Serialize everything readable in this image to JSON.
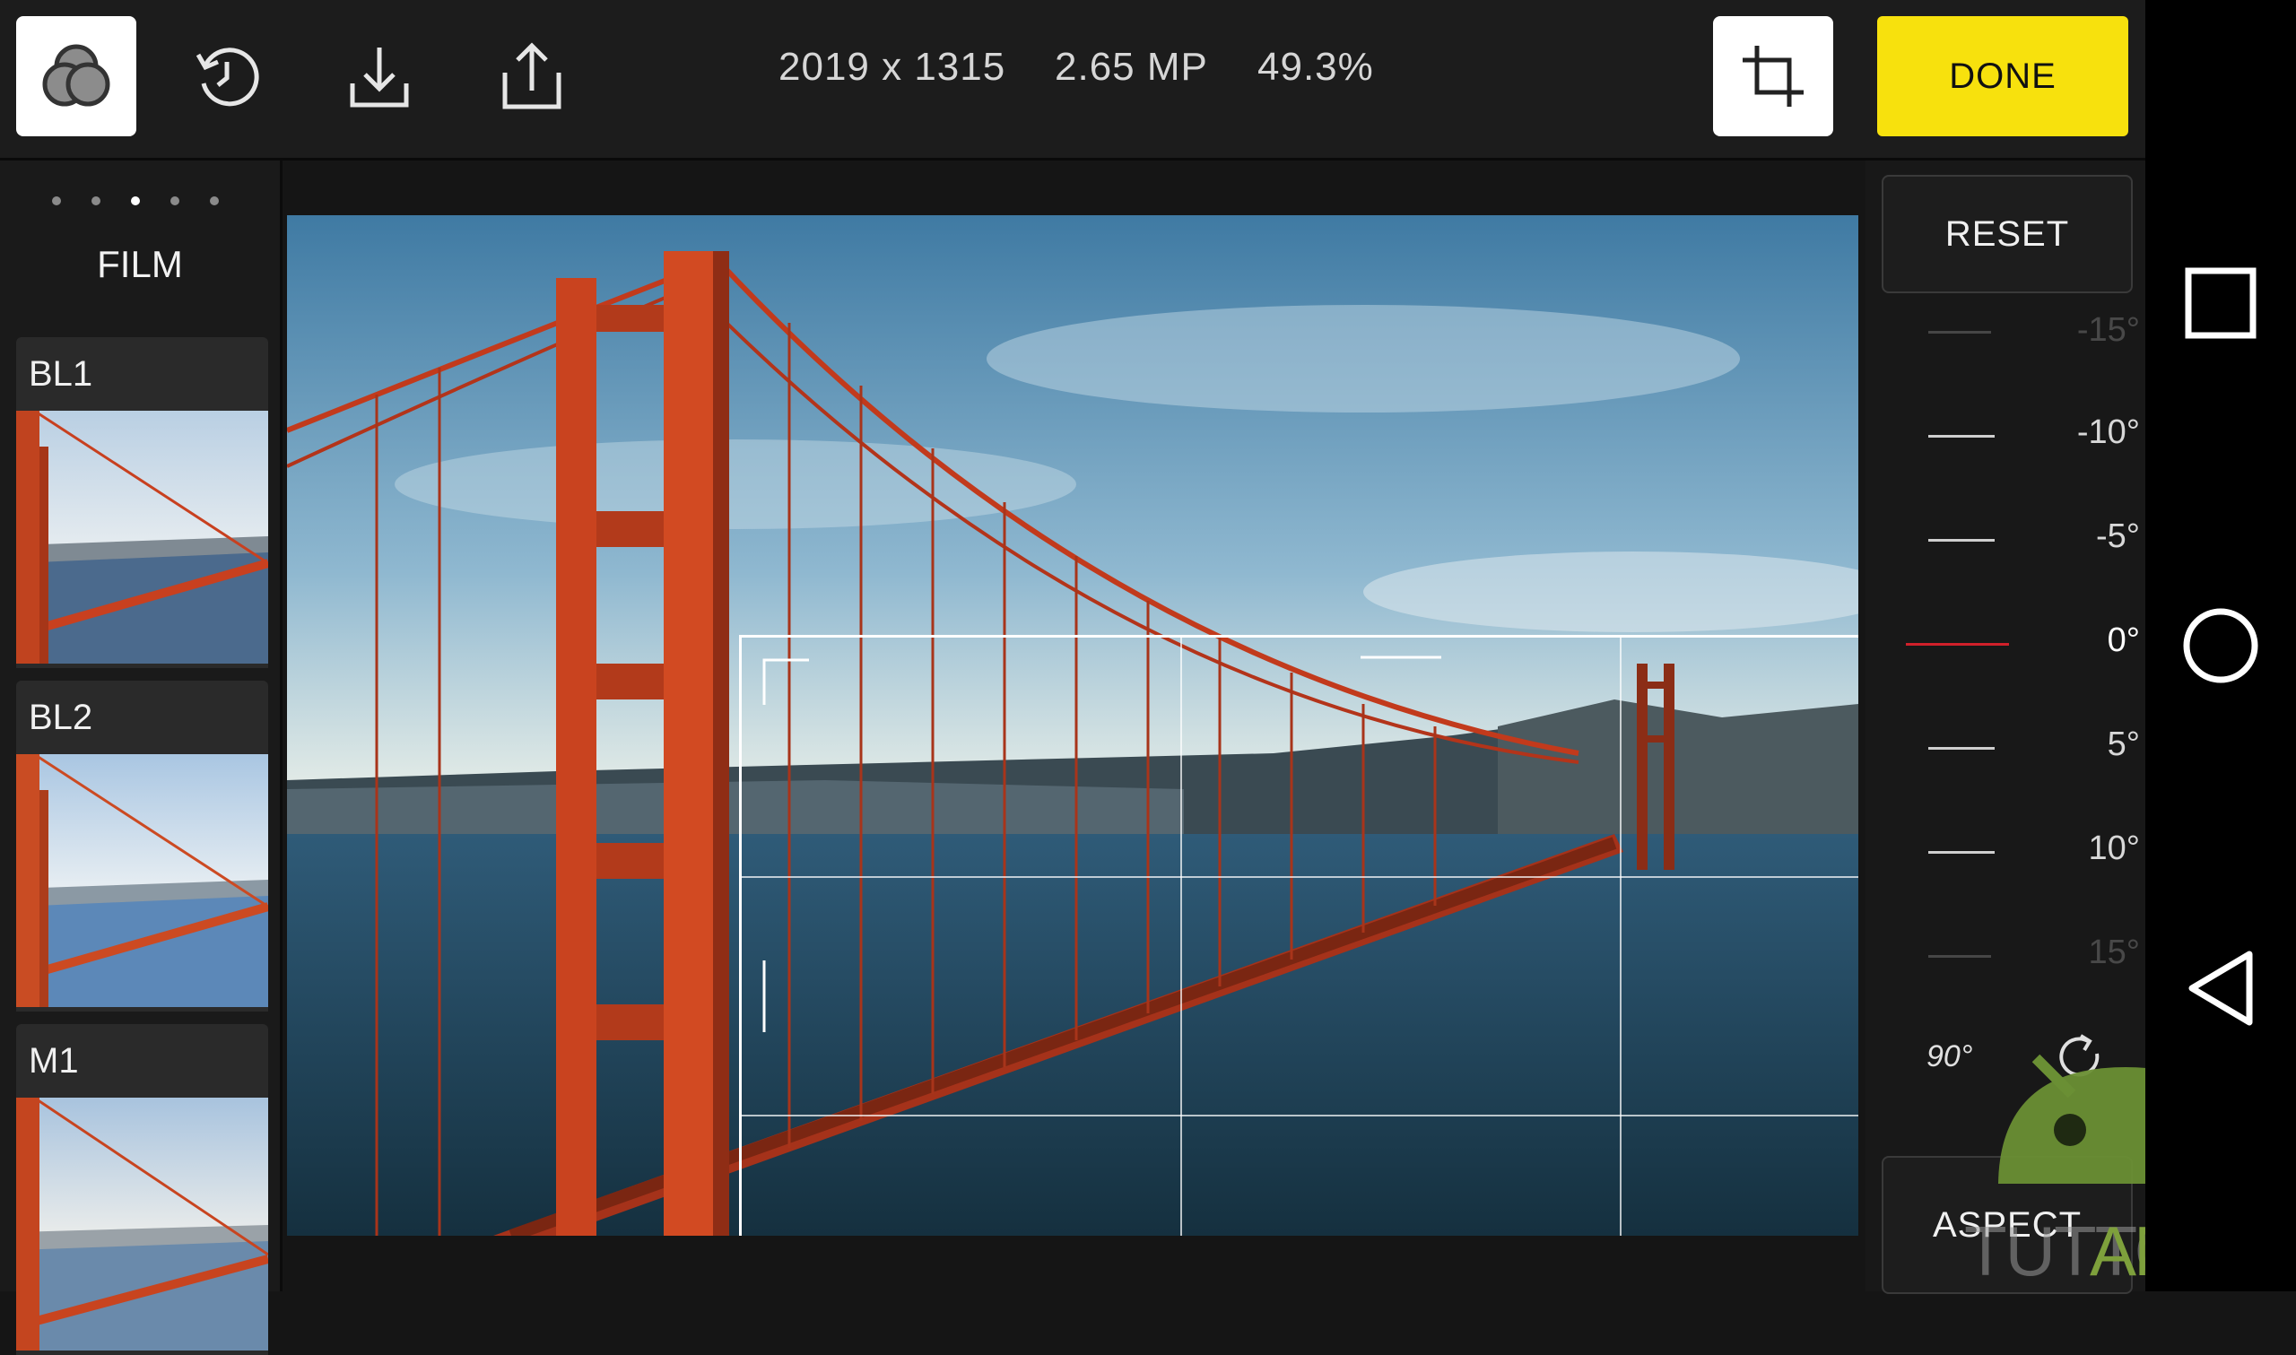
{
  "toolbar": {
    "image_dimensions": "2019 x 1315",
    "megapixels": "2.65 MP",
    "zoom": "49.3%",
    "done_label": "DONE",
    "icons": [
      "filters-icon",
      "history-icon",
      "download-icon",
      "share-icon",
      "crop-icon"
    ]
  },
  "filters": {
    "category": "FILM",
    "page_dots": 5,
    "active_dot": 3,
    "items": [
      {
        "label": "BL1"
      },
      {
        "label": "BL2"
      },
      {
        "label": "M1"
      }
    ]
  },
  "straighten": {
    "reset_label": "RESET",
    "faded_top": "-15°",
    "ticks": [
      {
        "label": "-10°",
        "value": -10
      },
      {
        "label": "-5°",
        "value": -5
      },
      {
        "label": "0°",
        "value": 0,
        "selected": true
      },
      {
        "label": "5°",
        "value": 5
      },
      {
        "label": "10°",
        "value": 10
      }
    ],
    "faded_bottom": "15°",
    "rotate_label": "90°",
    "aspect_label": "ASPECT"
  },
  "colors": {
    "accent": "#f7e10d",
    "selected_tick": "#d0202a"
  },
  "watermark": {
    "text_left": "TUTTO",
    "text_right": "ANDROID"
  },
  "nav": {
    "icons": [
      "recents-icon",
      "home-icon",
      "back-icon"
    ]
  }
}
